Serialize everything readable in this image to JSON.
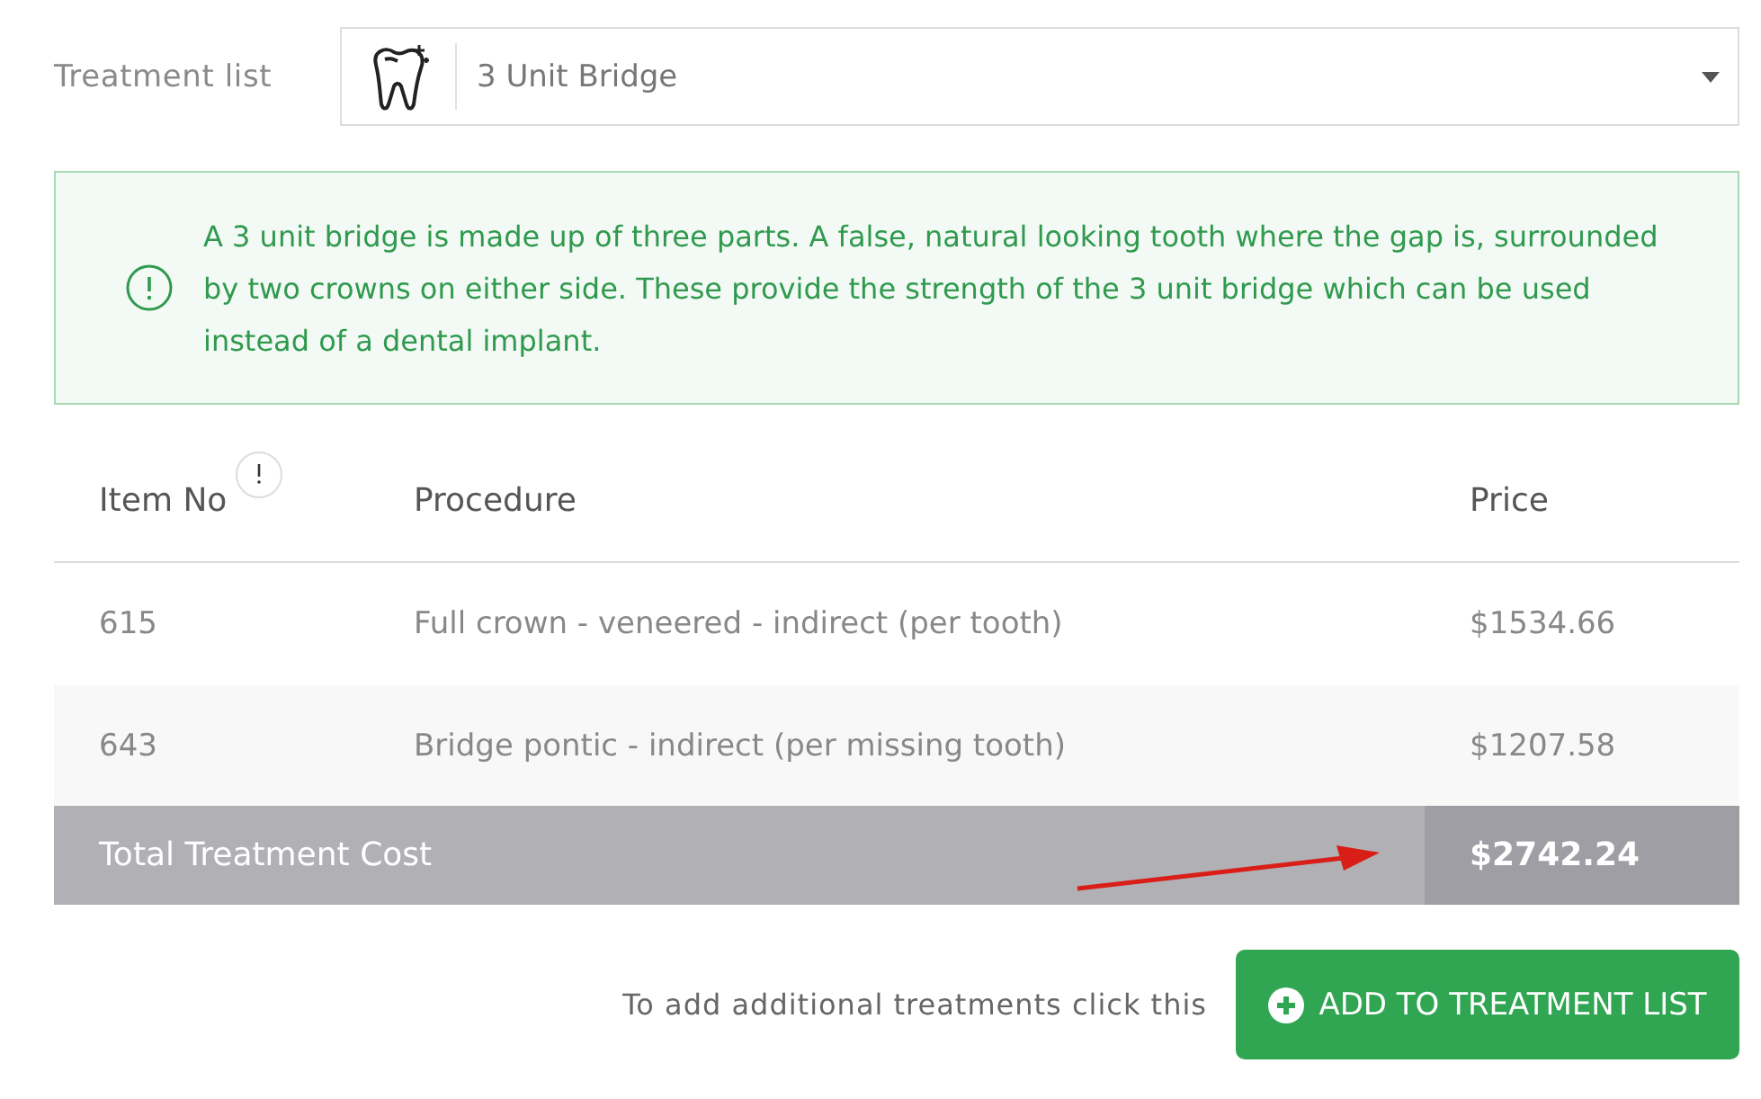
{
  "treatment_select": {
    "label": "Treatment list",
    "value": "3 Unit Bridge"
  },
  "info_alert": {
    "text": "A 3 unit bridge is made up of three parts. A false, natural looking tooth where the gap is, surrounded by two crowns on either side. These provide the strength of the 3 unit bridge which can be used instead of a dental implant."
  },
  "table": {
    "columns": [
      "Item No",
      "Procedure",
      "Price"
    ],
    "rows": [
      {
        "item_no": "615",
        "procedure": "Full crown - veneered - indirect (per tooth)",
        "price": "$1534.66"
      },
      {
        "item_no": "643",
        "procedure": "Bridge pontic - indirect (per missing tooth)",
        "price": "$1207.58"
      }
    ],
    "total": {
      "label": "Total Treatment Cost",
      "price": "$2742.24"
    }
  },
  "footer": {
    "hint": "To add additional treatments click this",
    "button": "ADD TO TREATMENT LIST"
  }
}
